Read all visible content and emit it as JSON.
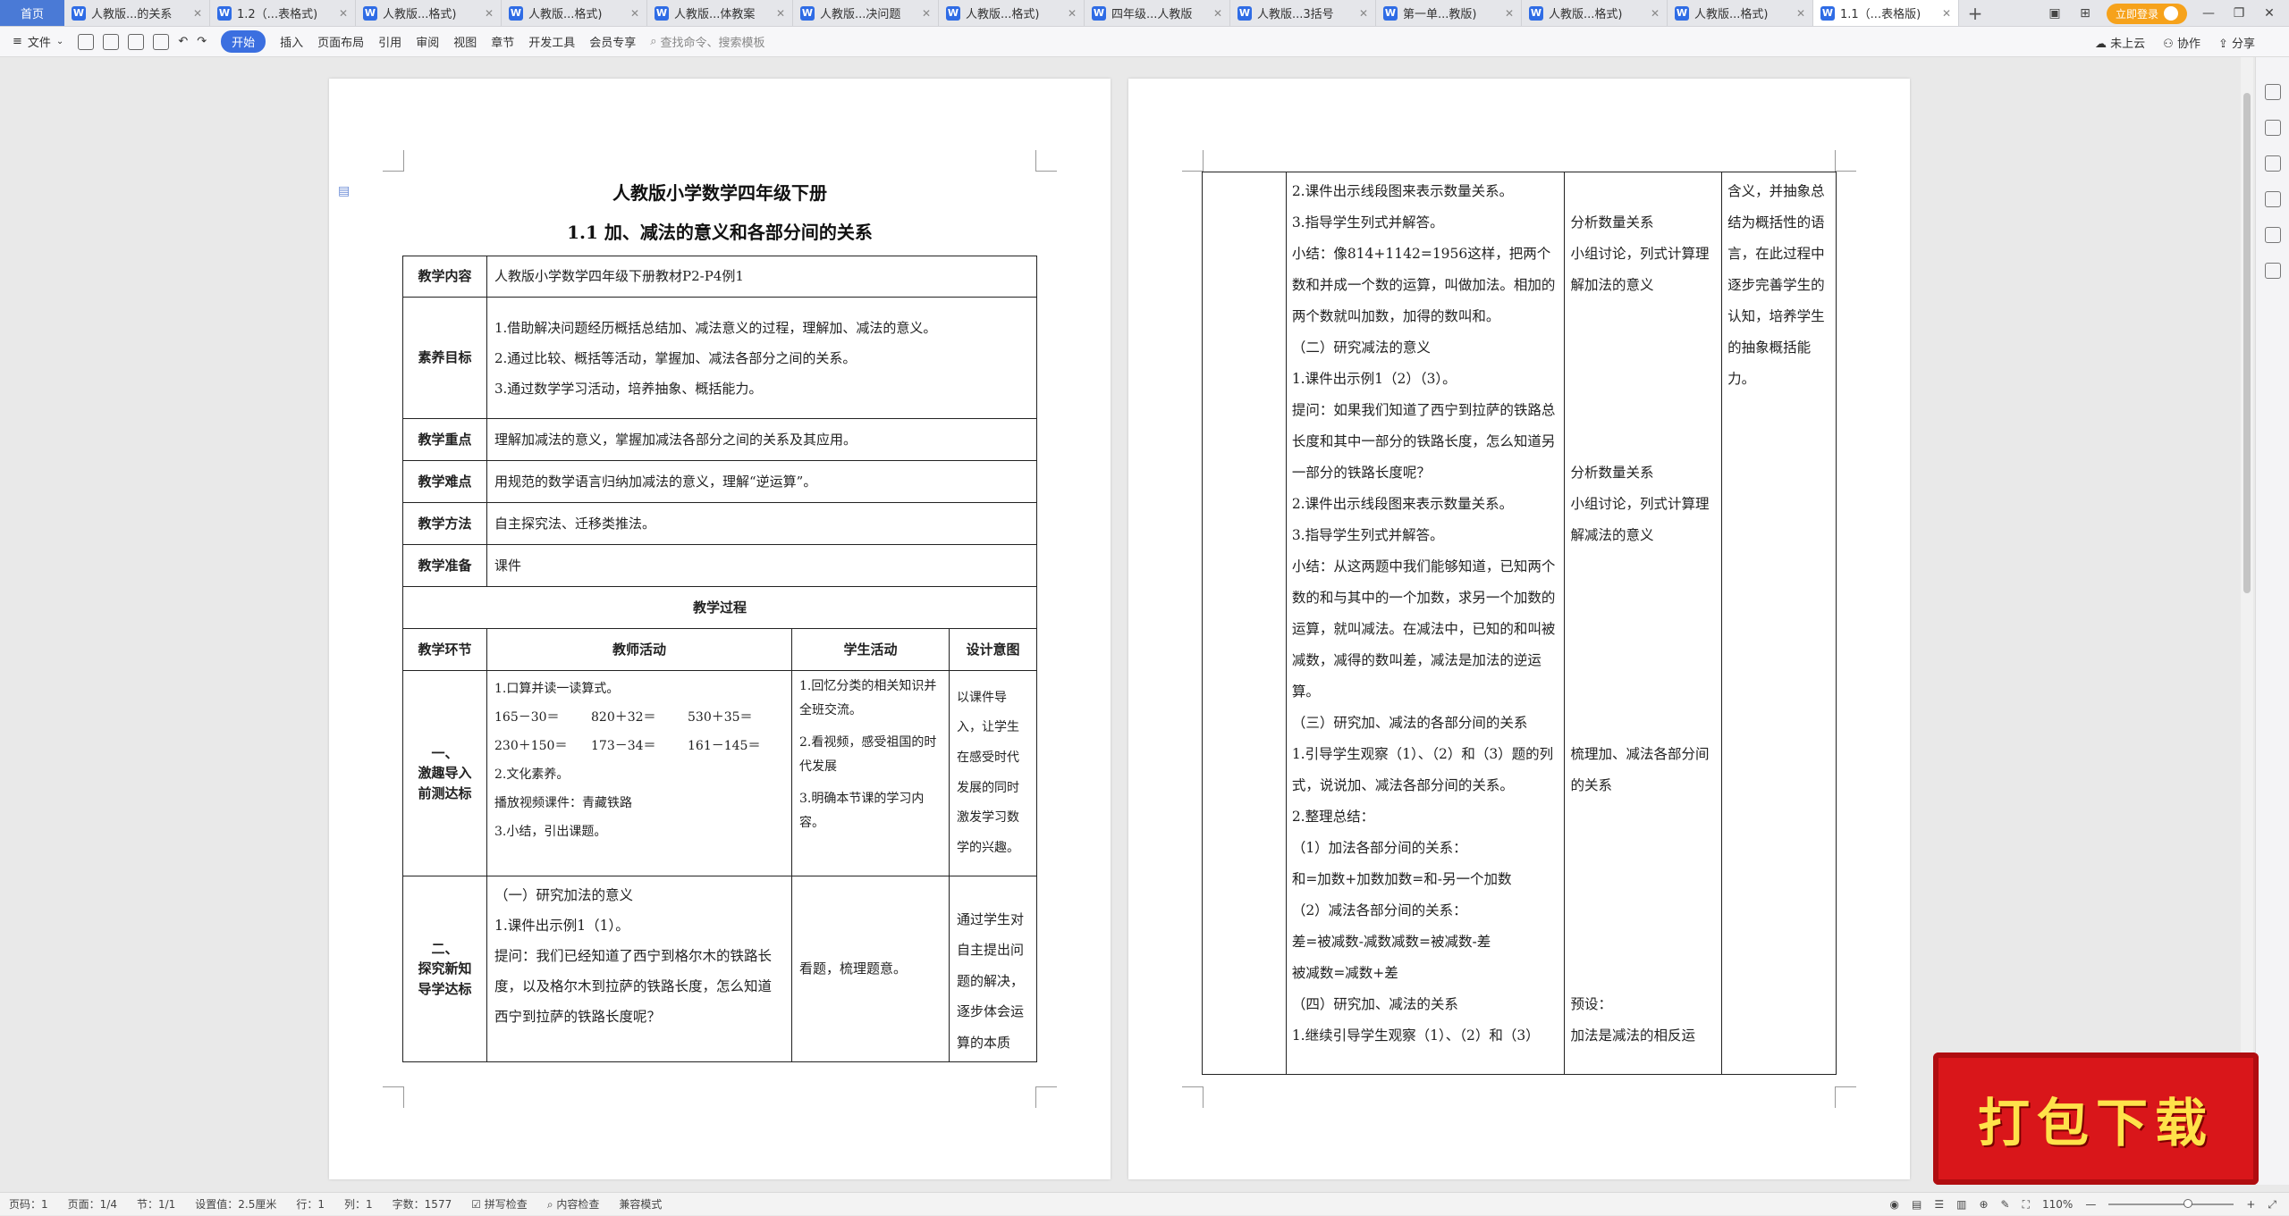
{
  "tabs": {
    "home": "首页",
    "items": [
      {
        "label": "人教版...的关系",
        "active": false
      },
      {
        "label": "1.2（...表格式)",
        "active": false
      },
      {
        "label": "人教版...格式)",
        "active": false
      },
      {
        "label": "人教版...格式)",
        "active": false
      },
      {
        "label": "人教版...体教案",
        "active": false
      },
      {
        "label": "人教版...决问题",
        "active": false
      },
      {
        "label": "人教版...格式)",
        "active": false
      },
      {
        "label": "四年级...人教版",
        "active": false
      },
      {
        "label": "人教版...3括号",
        "active": false
      },
      {
        "label": "第一单...教版)",
        "active": false
      },
      {
        "label": "人教版...格式)",
        "active": false
      },
      {
        "label": "人教版...格式)",
        "active": false
      },
      {
        "label": "1.1（...表格版)",
        "active": true
      }
    ],
    "add": "+",
    "login": "立即登录"
  },
  "toolbar": {
    "file": "文件",
    "start": "开始",
    "menus": [
      "插入",
      "页面布局",
      "引用",
      "审阅",
      "视图",
      "章节",
      "开发工具",
      "会员专享"
    ],
    "search": "查找命令、搜索模板",
    "cloud": "未上云",
    "collab": "协作",
    "share": "分享"
  },
  "doc": {
    "title": "人教版小学数学四年级下册",
    "subtitle": "1.1  加、减法的意义和各部分间的关系",
    "rows": {
      "content_label": "教学内容",
      "content": "人教版小学数学四年级下册教材P2-P4例1",
      "goal_label": "素养目标",
      "goals": [
        "1.借助解决问题经历概括总结加、减法意义的过程，理解加、减法的意义。",
        "2.通过比较、概括等活动，掌握加、减法各部分之间的关系。",
        "3.通过数学学习活动，培养抽象、概括能力。"
      ],
      "key_label": "教学重点",
      "key": "理解加减法的意义，掌握加减法各部分之间的关系及其应用。",
      "difficulty_label": "教学难点",
      "difficulty": "用规范的数学语言归纳加减法的意义，理解“逆运算”。",
      "method_label": "教学方法",
      "method": "自主探究法、迁移类推法。",
      "prep_label": "教学准备",
      "prep": "课件",
      "process": "教学过程",
      "col_stage": "教学环节",
      "col_teacher": "教师活动",
      "col_student": "学生活动",
      "col_intent": "设计意图"
    },
    "stage1": {
      "name": [
        "一、",
        "激趣导入",
        "前测达标"
      ],
      "teacher": [
        "1.口算并读一读算式。"
      ],
      "formulas": [
        [
          "165－30＝",
          "820＋32＝",
          "530＋35＝"
        ],
        [
          "230＋150＝",
          "173－34＝",
          "161－145＝"
        ]
      ],
      "teacher2": [
        "2.文化素养。",
        "播放视频课件：青藏铁路",
        "3.小结，引出课题。"
      ],
      "student": [
        "1.回忆分类的相关知识并全班交流。",
        "2.看视频，感受祖国的时代发展",
        "3.明确本节课的学习内容。"
      ],
      "intent": "以课件导入，让学生在感受时代发展的同时激发学习数学的兴趣。"
    },
    "stage2": {
      "name": [
        "二、",
        "探究新知",
        "导学达标"
      ],
      "teacher": [
        "（一）研究加法的意义",
        "1.课件出示例1（1）。",
        "提问：我们已经知道了西宁到格尔木的铁路长度，以及格尔木到拉萨的铁路长度，怎么知道西宁到拉萨的铁路长度呢？"
      ],
      "student": "看题，梳理题意。",
      "intent": "通过学生对自主提出问题的解决，逐步体会运算的本质"
    }
  },
  "page2": {
    "teacher": [
      "2.课件出示线段图来表示数量关系。",
      "3.指导学生列式并解答。",
      "小结：像814+1142=1956这样，把两个数和并成一个数的运算，叫做加法。相加的两个数就叫加数，加得的数叫和。",
      "（二）研究减法的意义",
      "1.课件出示例1（2）（3）。",
      "提问：如果我们知道了西宁到拉萨的铁路总长度和其中一部分的铁路长度，怎么知道另一部分的铁路长度呢？",
      "2.课件出示线段图来表示数量关系。",
      "3.指导学生列式并解答。",
      "小结：从这两题中我们能够知道，已知两个数的和与其中的一个加数，求另一个加数的运算，就叫减法。在减法中，已知的和叫被减数，减得的数叫差，减法是加法的逆运算。",
      "（三）研究加、减法的各部分间的关系",
      "1.引导学生观察（1）、（2）和（3）题的列式，说说加、减法各部分间的关系。",
      "2.整理总结：",
      "（1）加法各部分间的关系：",
      "和=加数+加数加数=和-另一个加数",
      "（2）减法各部分间的关系：",
      "差=被减数-减数减数=被减数-差",
      "被减数=减数+差",
      "（四）研究加、减法的关系",
      "1.继续引导学生观察（1）、（2）和（3）"
    ],
    "student_a": [
      "分析数量关系",
      "小组讨论，列式计算理解加法的意义"
    ],
    "student_b": [
      "分析数量关系",
      "小组讨论，列式计算理解减法的意义"
    ],
    "student_c": [
      "梳理加、减法各部分间的关系"
    ],
    "student_d": [
      "预设：",
      "加法是减法的相反运"
    ],
    "intent": "含义，并抽象总结为概括性的语言，在此过程中逐步完善学生的认知，培养学生的抽象概括能力。"
  },
  "status": {
    "page": "页码：1",
    "pages": "页面：1/4",
    "section": "节：1/1",
    "setting": "设置值：2.5厘米",
    "row": "行：1",
    "col": "列：1",
    "words": "字数：1577",
    "spell": "拼写检查",
    "content_check": "内容检查",
    "compat": "兼容模式",
    "zoom": "110%",
    "zoom_level": 0.63
  },
  "banner": "打包下载"
}
